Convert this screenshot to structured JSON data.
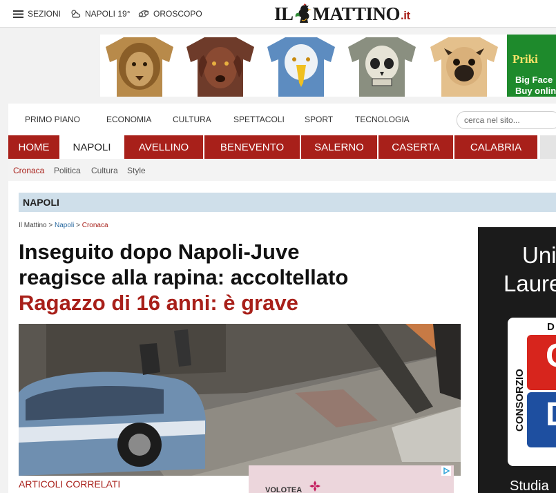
{
  "topbar": {
    "sections_label": "SEZIONI",
    "weather_label": "NAPOLI 19°",
    "horoscope_label": "OROSCOPO"
  },
  "logo": {
    "left": "IL",
    "right": "MATTINO",
    "tld": ".it"
  },
  "banner": {
    "shirts": [
      "lion-tshirt",
      "dog-tshirt",
      "eagle-tshirt",
      "skull-tshirt",
      "pug-tshirt"
    ],
    "ad_brand": "Priki",
    "ad_line1": "Big Face",
    "ad_line2": "Buy onlin"
  },
  "nav": {
    "items": [
      "PRIMO PIANO",
      "ECONOMIA",
      "CULTURA",
      "SPETTACOLI",
      "SPORT",
      "TECNOLOGIA"
    ],
    "search_placeholder": "cerca nel sito..."
  },
  "city_tabs": [
    "HOME",
    "NAPOLI",
    "AVELLINO",
    "BENEVENTO",
    "SALERNO",
    "CASERTA",
    "CALABRIA"
  ],
  "active_city": "NAPOLI",
  "subnav": [
    "Cronaca",
    "Politica",
    "Cultura",
    "Style"
  ],
  "section_title": "NAPOLI",
  "breadcrumb": {
    "home": "Il Mattino",
    "sep": ">",
    "section": "Napoli",
    "current": "Cronaca"
  },
  "article": {
    "title_line1": "Inseguito dopo Napoli-Juve",
    "title_line2": "reagisce alla rapina: accoltellato",
    "subtitle": "Ragazzo di 16 anni: è grave",
    "related_label": "ARTICOLI CORRELATI"
  },
  "ads": {
    "volotea_label": "VOLOTEA",
    "sidebar_line1": "Uni",
    "sidebar_line2": "Laure",
    "sidebar_card_vertical": "CONSORZIO",
    "sidebar_card_top": "D",
    "sidebar_card_letter1": "C",
    "sidebar_card_letter2": "D",
    "sidebar_line3": "Studia"
  },
  "colors": {
    "accent": "#a8201a",
    "section_bar": "#cfdfea",
    "link": "#2a6aa0"
  }
}
